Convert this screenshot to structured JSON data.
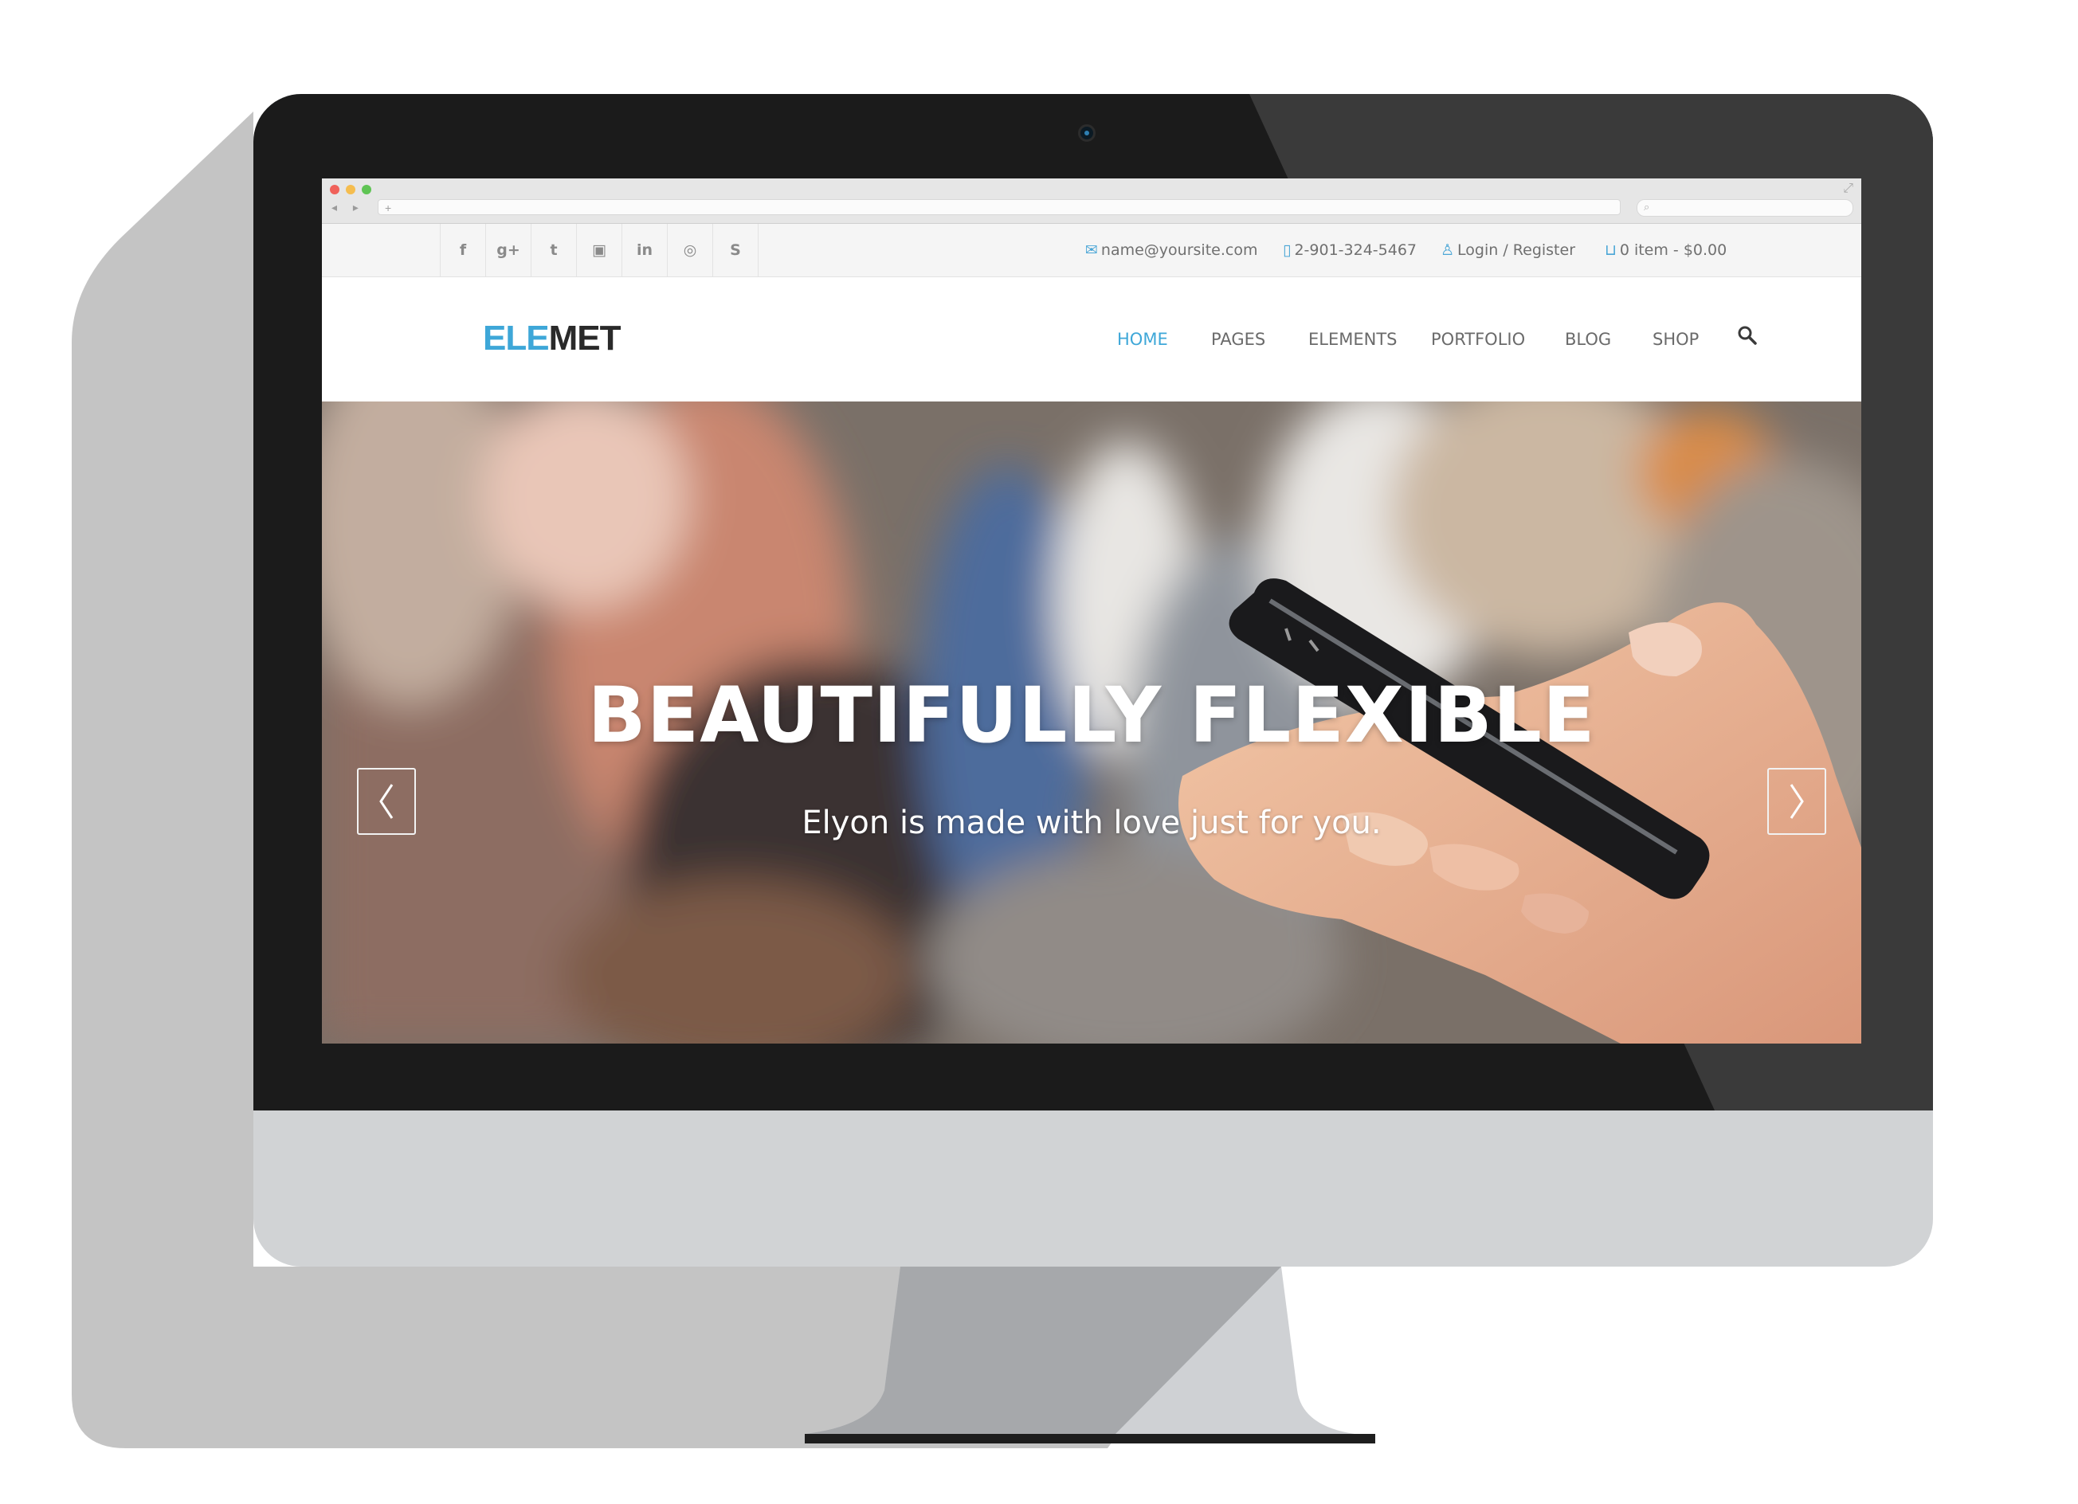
{
  "browser": {
    "url": "+",
    "window_controls": [
      "close",
      "minimize",
      "maximize"
    ],
    "nav_arrows": "◂ ▸"
  },
  "topbar": {
    "social_icons": [
      "facebook-icon",
      "google-plus-icon",
      "twitter-icon",
      "youtube-icon",
      "linkedin-icon",
      "dribbble-icon",
      "skype-icon"
    ],
    "social_glyphs": [
      "f",
      "g+",
      "t",
      "▣",
      "in",
      "◎",
      "S"
    ],
    "email": "name@yoursite.com",
    "phone": "2-901-324-5467",
    "login": "Login / Register",
    "cart": "0 item - $0.00"
  },
  "header": {
    "logo_part1": "ELE",
    "logo_part2": "MET",
    "nav": [
      "HOME",
      "PAGES",
      "ELEMENTS",
      "PORTFOLIO",
      "BLOG",
      "SHOP"
    ],
    "active_nav": "HOME"
  },
  "hero": {
    "title": "BEAUTIFULLY FLEXIBLE",
    "subtitle": "Elyon is made with love just for you."
  },
  "colors": {
    "accent": "#3ea7d8",
    "bezel": "#1b1b1b",
    "monitor_chin": "#d1d3d5",
    "shadow": "#c2c2c2"
  }
}
